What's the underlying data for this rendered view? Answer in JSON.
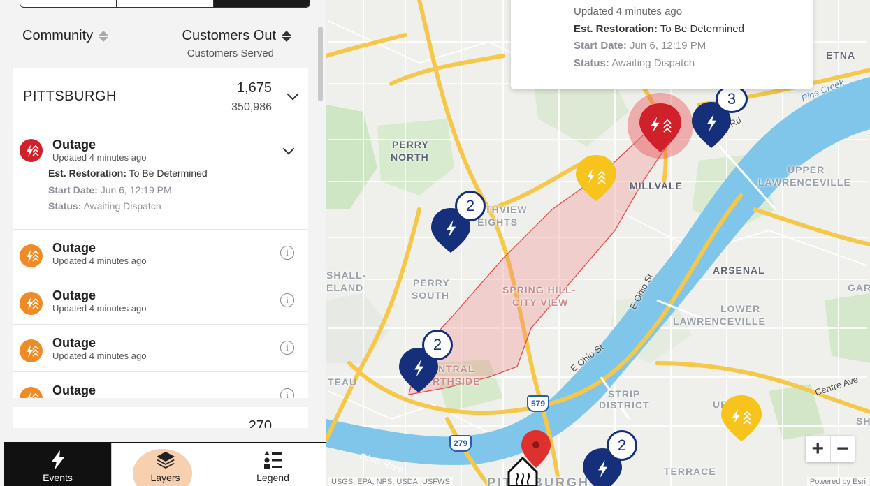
{
  "panel": {
    "columns": {
      "community": "Community",
      "customers_out": "Customers Out",
      "customers_served": "Customers Served"
    },
    "community_row": {
      "name": "PITTSBURGH",
      "customers_out": "1,675",
      "customers_served": "350,986"
    },
    "expanded_event": {
      "title": "Outage",
      "updated": "Updated 4 minutes ago",
      "restoration_label": "Est. Restoration:",
      "restoration_value": "To Be Determined",
      "start_label": "Start Date:",
      "start_value": "Jun 6, 12:19 PM",
      "status_label": "Status:",
      "status_value": "Awaiting Dispatch"
    },
    "events": [
      {
        "title": "Outage",
        "updated": "Updated 4 minutes ago"
      },
      {
        "title": "Outage",
        "updated": "Updated 4 minutes ago"
      },
      {
        "title": "Outage",
        "updated": "Updated 4 minutes ago"
      },
      {
        "title": "Outage",
        "updated": ""
      }
    ],
    "next_row_value": "270"
  },
  "bottom_nav": {
    "events": "Events",
    "layers": "Layers",
    "legend": "Legend"
  },
  "popup": {
    "updated": "Updated 4 minutes ago",
    "restoration_label": "Est. Restoration:",
    "restoration_value": "To Be Determined",
    "start_label": "Start Date:",
    "start_value": "Jun 6, 12:19 PM",
    "status_label": "Status:",
    "status_value": "Awaiting Dispatch"
  },
  "map": {
    "labels": {
      "etna": "ETNA",
      "perry_north_1": "PERRY",
      "perry_north_2": "NORTH",
      "millvale": "MILLVALE",
      "upper_lawrenceville_1": "UPPER",
      "upper_lawrenceville_2": "LAWRENCEVILLE",
      "northview_1": "RTHVIEW",
      "northview_2": "EIGHTS",
      "arsenal": "ARSENAL",
      "marshall_1": "SHALL-",
      "marshall_2": "ELAND",
      "perry_south_1": "PERRY",
      "perry_south_2": "SOUTH",
      "spring_hill_1": "SPRING HILL-",
      "spring_hill_2": "CITY VIEW",
      "gar": "GAR",
      "lower_lawrenceville_1": "LOWER",
      "lower_lawrenceville_2": "LAWRENCEVILLE",
      "central_northside_1": "NTRAL",
      "central_northside_2": "RTHSIDE",
      "teau": "TEAU",
      "strip_1": "STRIP",
      "strip_2": "DISTRICT",
      "up_hill": "UP   HILL",
      "terrace": "TERRACE",
      "pittsburgh": "PITTSBURGH",
      "sh": "SH"
    },
    "roads": {
      "pine_creek": "Pine Creek",
      "ferry_rd": "Ferry Rd",
      "e_ohio_st_1": "E Ohio St",
      "e_ohio_st_2": "E Ohio St",
      "centre_ave": "Centre Ave",
      "ohio_river": "Ohio Rive",
      "i579": "579",
      "i279": "279"
    },
    "clusters": [
      {
        "count": "3"
      },
      {
        "count": "2"
      },
      {
        "count": "2"
      },
      {
        "count": "2"
      }
    ],
    "attribution_left": "USGS, EPA, NPS, USDA, USFWS",
    "attribution_right": "Powered by Esri",
    "colors": {
      "outage_red": "#d0202a",
      "outage_orange": "#f08a24",
      "crew_navy": "#152f7a",
      "yellow_pin": "#f6c41d",
      "river": "#7fc6ea",
      "highway": "#f5c84b"
    }
  },
  "zoom": {
    "in": "+",
    "out": "−"
  }
}
